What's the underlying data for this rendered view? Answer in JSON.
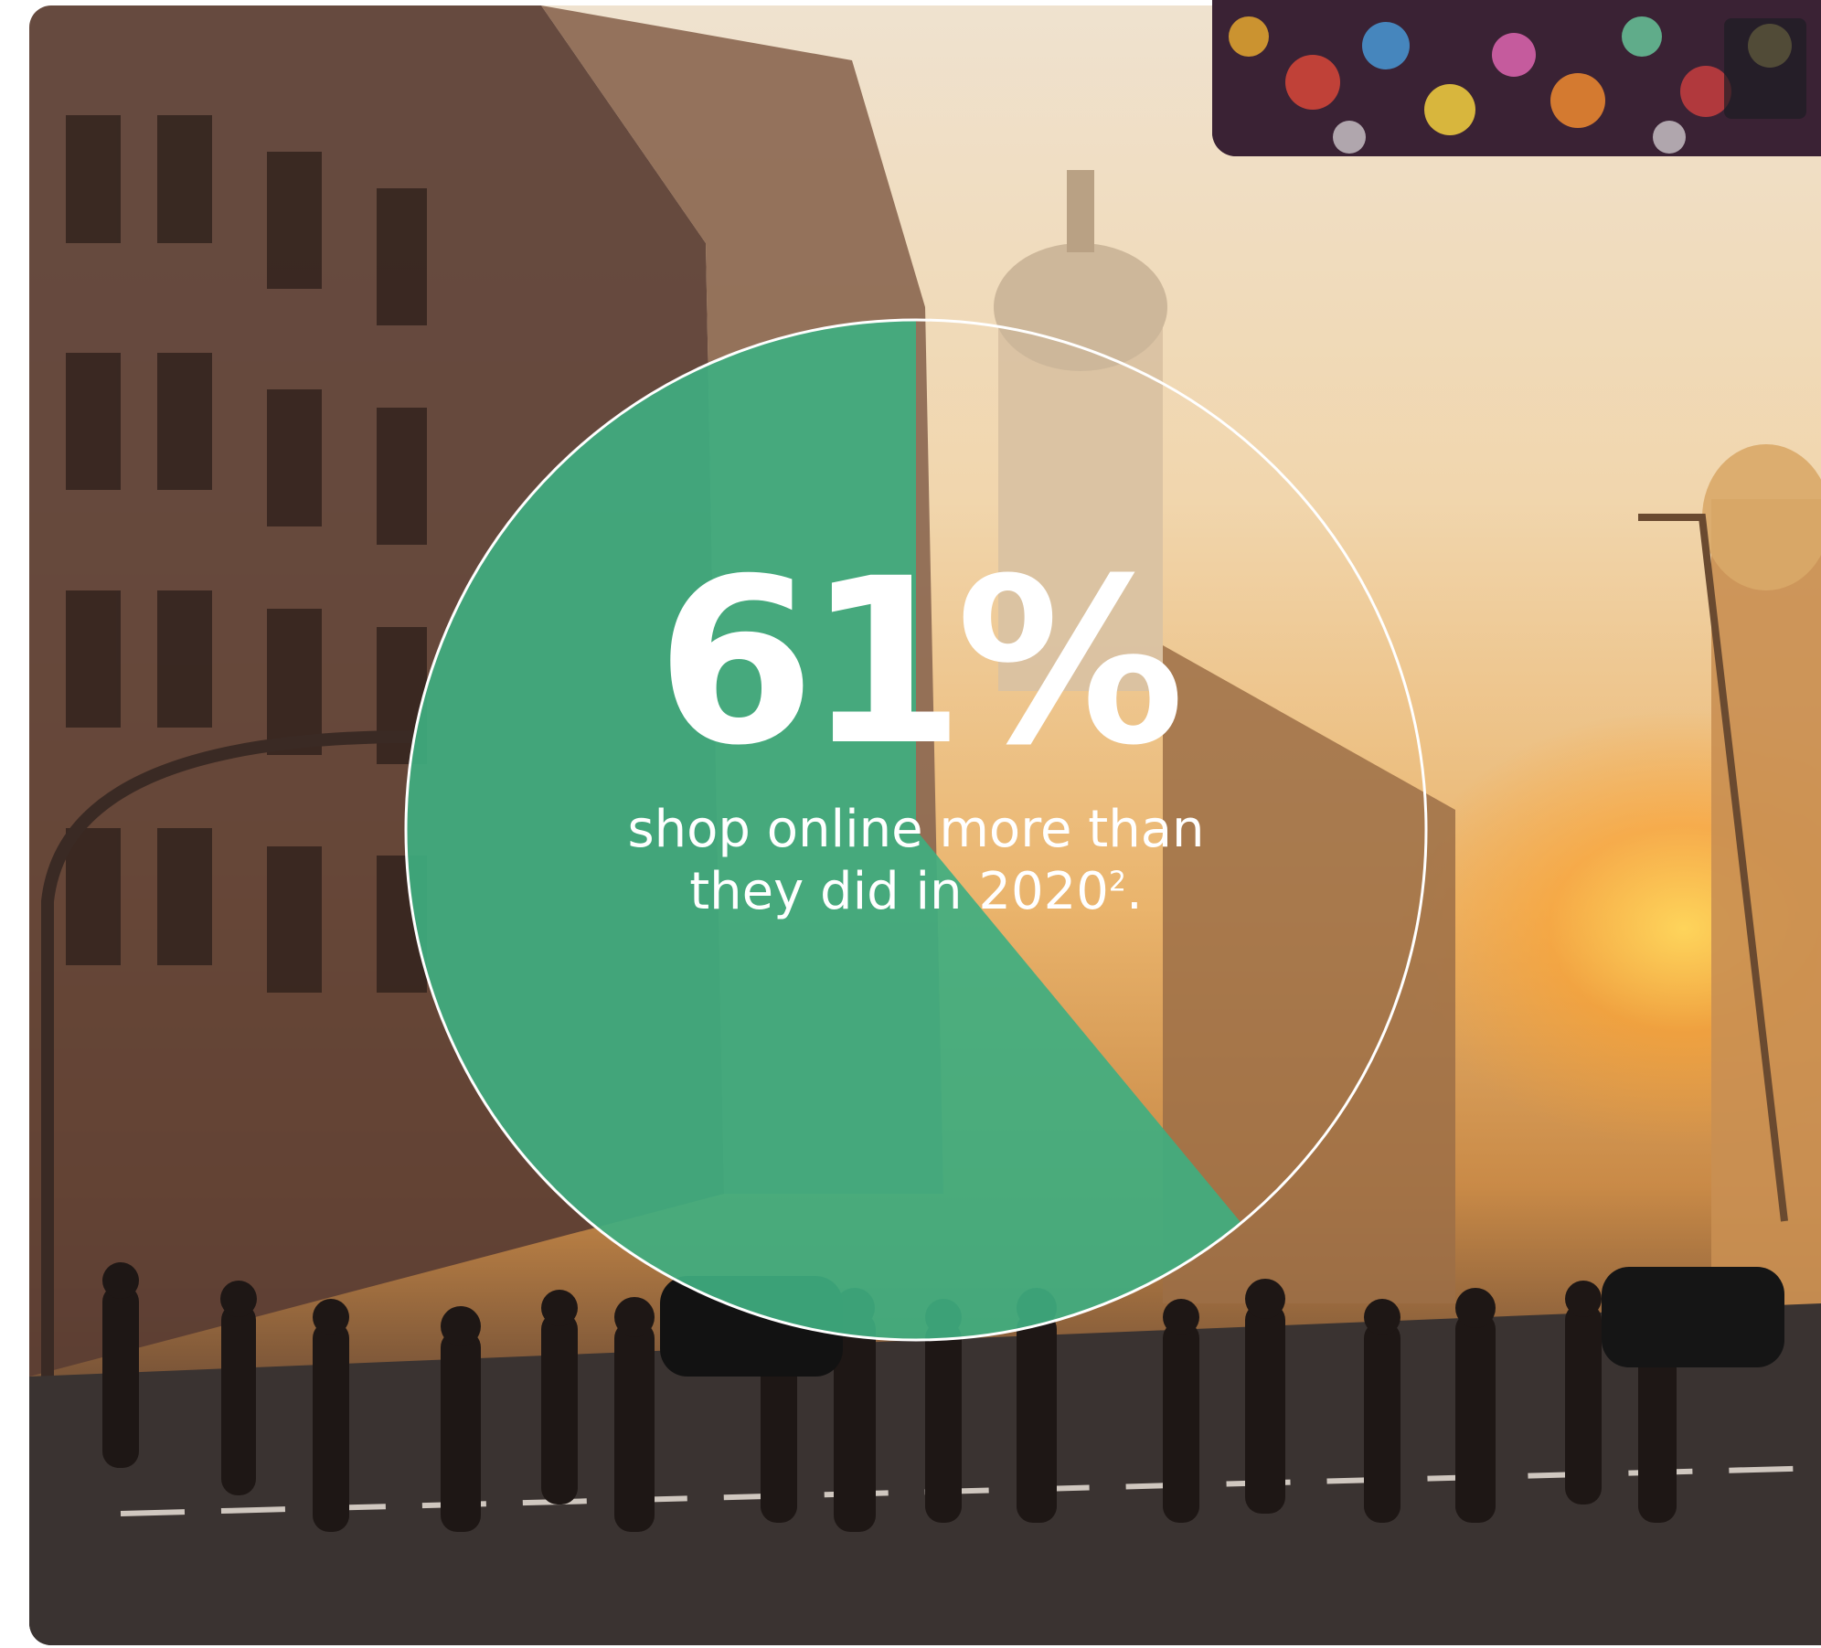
{
  "stat": {
    "value": "61%",
    "fraction": 0.61,
    "caption_line1": "shop online more than",
    "caption_line2_text": "they did in 2020",
    "caption_footnote": "2",
    "caption_end": "."
  },
  "colors": {
    "accent_green": "#3fae80",
    "ring_stroke": "#ffffff"
  }
}
